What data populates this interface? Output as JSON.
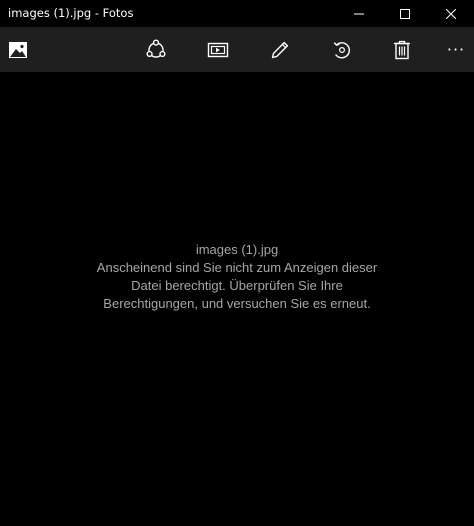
{
  "window": {
    "title": "images (1).jpg - Fotos"
  },
  "toolbar": {
    "buttons": [
      {
        "name": "gallery",
        "icon": "image-icon"
      },
      {
        "name": "share",
        "icon": "share-icon"
      },
      {
        "name": "slideshow",
        "icon": "slideshow-icon"
      },
      {
        "name": "edit",
        "icon": "pencil-icon"
      },
      {
        "name": "rotate",
        "icon": "rotate-icon"
      },
      {
        "name": "delete",
        "icon": "trash-icon"
      },
      {
        "name": "more",
        "icon": "more-icon"
      }
    ],
    "more_label": "···"
  },
  "message": {
    "filename": "images (1).jpg",
    "lines": [
      "Anscheinend sind Sie nicht zum Anzeigen dieser",
      "Datei berechtigt. Überprüfen Sie Ihre",
      "Berechtigungen, und versuchen Sie es erneut."
    ]
  },
  "colors": {
    "background": "#000000",
    "toolbar": "#1f1f1f",
    "message_text": "#a6a6a6",
    "icon": "#ffffff"
  }
}
